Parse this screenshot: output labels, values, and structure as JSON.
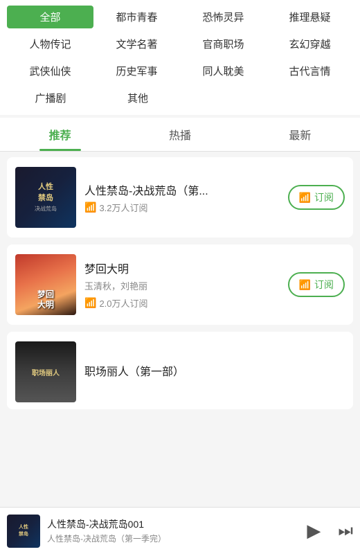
{
  "categories": [
    [
      {
        "label": "全部",
        "active": true
      },
      {
        "label": "都市青春",
        "active": false
      },
      {
        "label": "恐怖灵异",
        "active": false
      },
      {
        "label": "推理悬疑",
        "active": false
      }
    ],
    [
      {
        "label": "人物传记",
        "active": false
      },
      {
        "label": "文学名著",
        "active": false
      },
      {
        "label": "官商职场",
        "active": false
      },
      {
        "label": "玄幻穿越",
        "active": false
      }
    ],
    [
      {
        "label": "武侠仙侠",
        "active": false
      },
      {
        "label": "历史军事",
        "active": false
      },
      {
        "label": "同人耽美",
        "active": false
      },
      {
        "label": "古代言情",
        "active": false
      }
    ],
    [
      {
        "label": "广播剧",
        "active": false
      },
      {
        "label": "其他",
        "active": false
      }
    ]
  ],
  "tabs": [
    {
      "label": "推荐",
      "active": true
    },
    {
      "label": "热播",
      "active": false
    },
    {
      "label": "最新",
      "active": false
    }
  ],
  "books": [
    {
      "id": 1,
      "title": "人性禁岛-决战荒岛（第...",
      "author": "",
      "subscribers": "3.2万人订阅",
      "subscribe_label": "订阅",
      "cover_lines": [
        "人性",
        "禁岛"
      ],
      "cover_sub": "决战荒岛"
    },
    {
      "id": 2,
      "title": "梦回大明",
      "author": "玉清秋，刘艳丽",
      "subscribers": "2.0万人订阅",
      "subscribe_label": "订阅",
      "cover_lines": [
        "梦",
        "回",
        "大",
        "明"
      ],
      "cover_sub": ""
    },
    {
      "id": 3,
      "title": "职场丽人（第一部）",
      "author": "",
      "subscribers": "",
      "subscribe_label": "",
      "cover_lines": [
        "职场丽人"
      ],
      "cover_sub": ""
    }
  ],
  "player": {
    "title": "人性禁岛-决战荒岛001",
    "subtitle": "人性禁岛-决战荒岛（第一季完）",
    "play_icon": "▶",
    "next_icon": "⏭",
    "cover_lines": [
      "人性",
      "禁岛"
    ]
  }
}
